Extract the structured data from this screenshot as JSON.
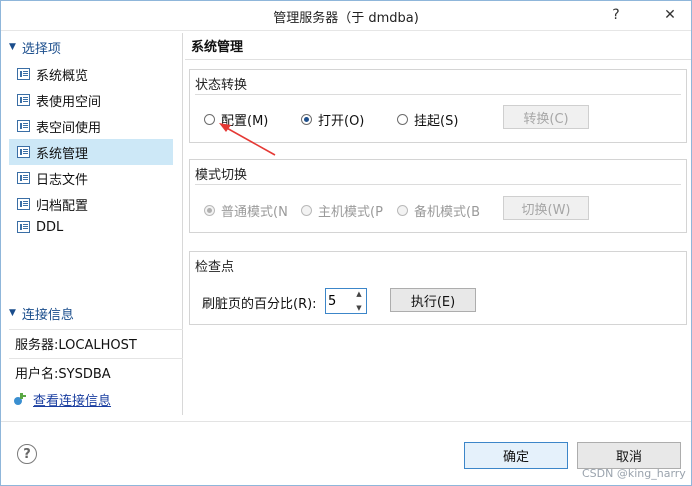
{
  "window": {
    "title": "管理服务器（于 dmdba)",
    "help_glyph": "?",
    "close_glyph": "✕"
  },
  "sidebar": {
    "options_header": "选择项",
    "items": [
      {
        "label": "系统概览",
        "selected": false
      },
      {
        "label": "表使用空间",
        "selected": false
      },
      {
        "label": "表空间使用",
        "selected": false
      },
      {
        "label": "系统管理",
        "selected": true
      },
      {
        "label": "日志文件",
        "selected": false
      },
      {
        "label": "归档配置",
        "selected": false
      },
      {
        "label": "DDL",
        "selected": false
      }
    ],
    "connection_header": "连接信息",
    "server": "服务器:LOCALHOST",
    "username": "用户名:SYSDBA",
    "view_connection_link": "查看连接信息"
  },
  "main": {
    "title": "系统管理",
    "state_group": {
      "title": "状态转换",
      "options": [
        "配置(M)",
        "打开(O)",
        "挂起(S)"
      ],
      "selected": "打开(O)",
      "button": "转换(C)"
    },
    "mode_group": {
      "title": "模式切换",
      "options": [
        "普通模式(N",
        "主机模式(P",
        "备机模式(B"
      ],
      "selected": "普通模式(N",
      "button": "切换(W)"
    },
    "checkpoint_group": {
      "title": "检查点",
      "label": "刷脏页的百分比(R):",
      "value": "5",
      "button": "执行(E)"
    }
  },
  "footer": {
    "ok": "确定",
    "cancel": "取消"
  },
  "watermark": "CSDN @king_harry",
  "colors": {
    "accent": "#3c86c9",
    "selected_bg": "#cde8f7",
    "annotation_arrow": "#e53935"
  }
}
